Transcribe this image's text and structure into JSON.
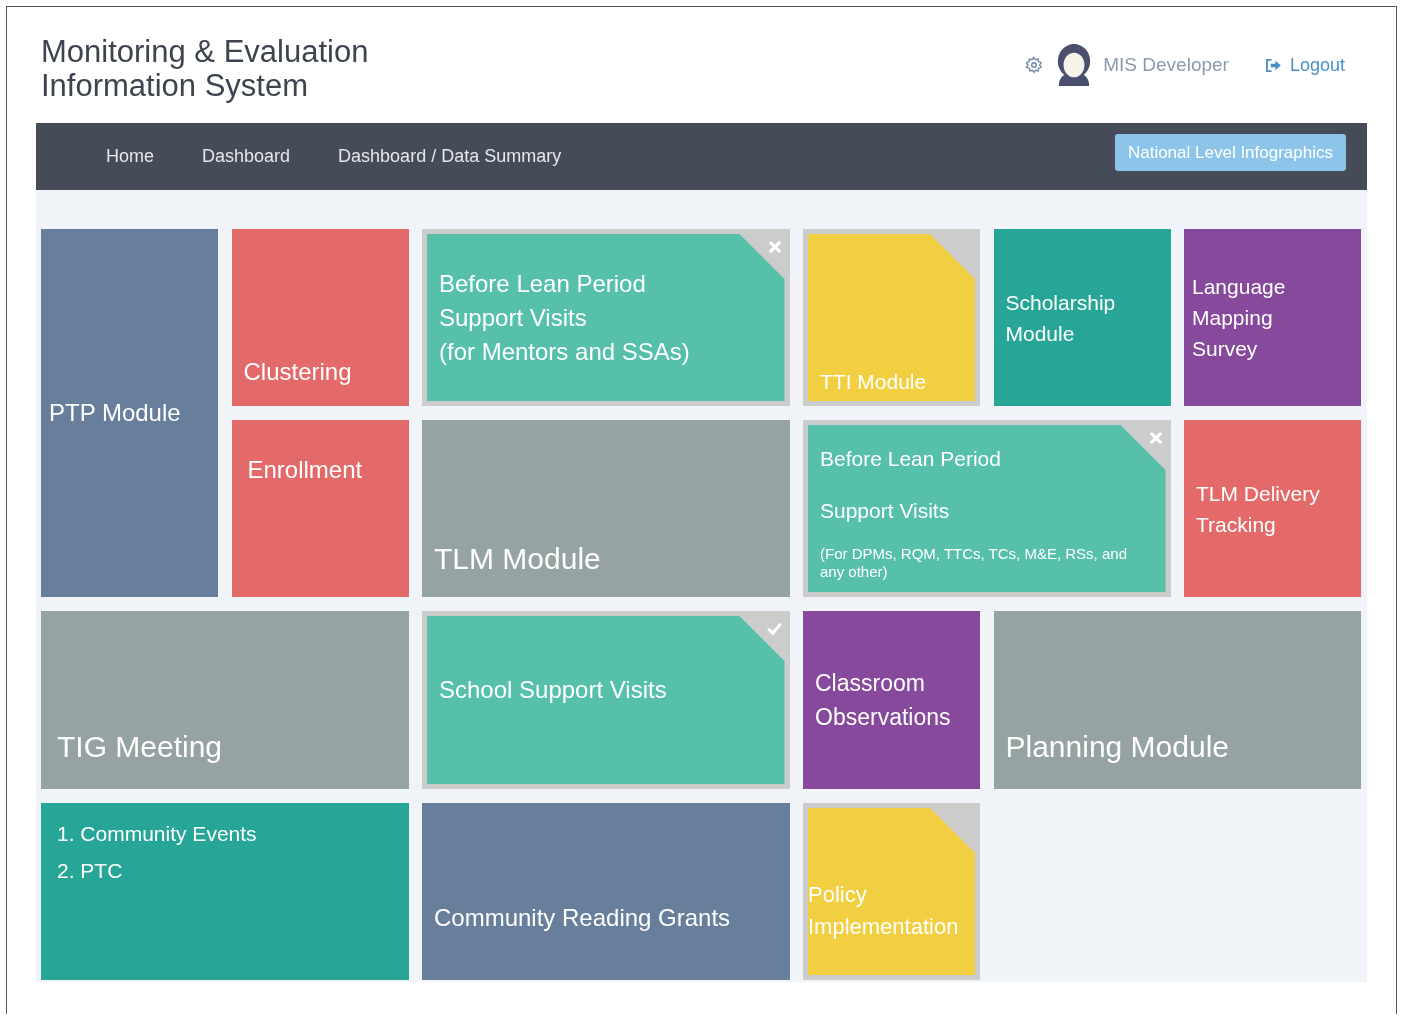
{
  "header": {
    "title_lines": [
      "Monitoring & Evaluation",
      "Information System"
    ],
    "user": "MIS Developer",
    "logout": "Logout"
  },
  "nav": {
    "items": [
      "Home",
      "Dashboard",
      "Dashboard / Data Summary"
    ],
    "button": "National Level Infographics"
  },
  "tiles": [
    {
      "kind": "plain",
      "color": "#687f9c",
      "lines": [
        "PTP Module"
      ]
    },
    {
      "kind": "plain",
      "color": "#e46a6a",
      "lines": [
        "Clustering"
      ]
    },
    {
      "kind": "folded",
      "closable": true,
      "checked": false,
      "color": "#56c0aa",
      "lines": [
        "Before Lean Period",
        "Support Visits",
        "(for Mentors and SSAs)"
      ]
    },
    {
      "kind": "folded",
      "closable": false,
      "checked": false,
      "color": "#f2cf40",
      "lines": [
        "TTI Module"
      ]
    },
    {
      "kind": "plain",
      "color": "#27a697",
      "lines": [
        "Scholarship",
        "Module"
      ]
    },
    {
      "kind": "plain",
      "color": "#86499b",
      "lines": [
        "Language",
        "Mapping",
        "Survey"
      ]
    },
    {
      "kind": "plain",
      "color": "#e46a6a",
      "lines": [
        "Enrollment"
      ]
    },
    {
      "kind": "plain",
      "color": "#95a3a2",
      "lines": [
        "TLM Module"
      ]
    },
    {
      "kind": "folded",
      "closable": true,
      "checked": false,
      "color": "#56c0aa",
      "lines": [
        "Before Lean Period",
        "Support Visits"
      ],
      "note": "(For DPMs, RQM, TTCs, TCs, M&E, RSs, and any other)"
    },
    {
      "kind": "plain",
      "color": "#e46a6a",
      "lines": [
        "TLM Delivery",
        "Tracking"
      ]
    },
    {
      "kind": "plain",
      "color": "#95a3a2",
      "lines": [
        "TIG Meeting"
      ]
    },
    {
      "kind": "folded",
      "closable": false,
      "checked": true,
      "color": "#56c0aa",
      "lines": [
        "School Support Visits"
      ]
    },
    {
      "kind": "plain",
      "color": "#86499b",
      "lines": [
        "Classroom",
        "Observations"
      ]
    },
    {
      "kind": "plain",
      "color": "#95a3a2",
      "lines": [
        "Planning Module"
      ]
    },
    {
      "kind": "plain",
      "color": "#27a697",
      "lines": [
        "1. Community Events",
        "2. PTC"
      ]
    },
    {
      "kind": "plain",
      "color": "#687f9c",
      "lines": [
        "Community Reading Grants"
      ]
    },
    {
      "kind": "folded",
      "closable": false,
      "checked": false,
      "color": "#f2cf40",
      "lines": [
        "Policy",
        "Implementation"
      ]
    }
  ]
}
